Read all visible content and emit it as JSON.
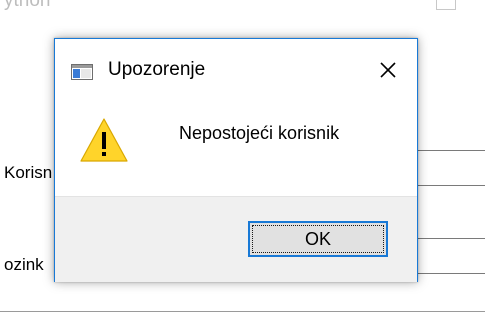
{
  "background": {
    "title_fragment": "ython",
    "label_username_fragment": "Korisn",
    "label_password_fragment": "ozink"
  },
  "dialog": {
    "title": "Upozorenje",
    "message": "Nepostojeći korisnik",
    "ok_label": "OK",
    "close_glyph": "✕",
    "icon": "warning-icon",
    "accent_color": "#1879d6",
    "warning_color": "#ffd42a"
  }
}
